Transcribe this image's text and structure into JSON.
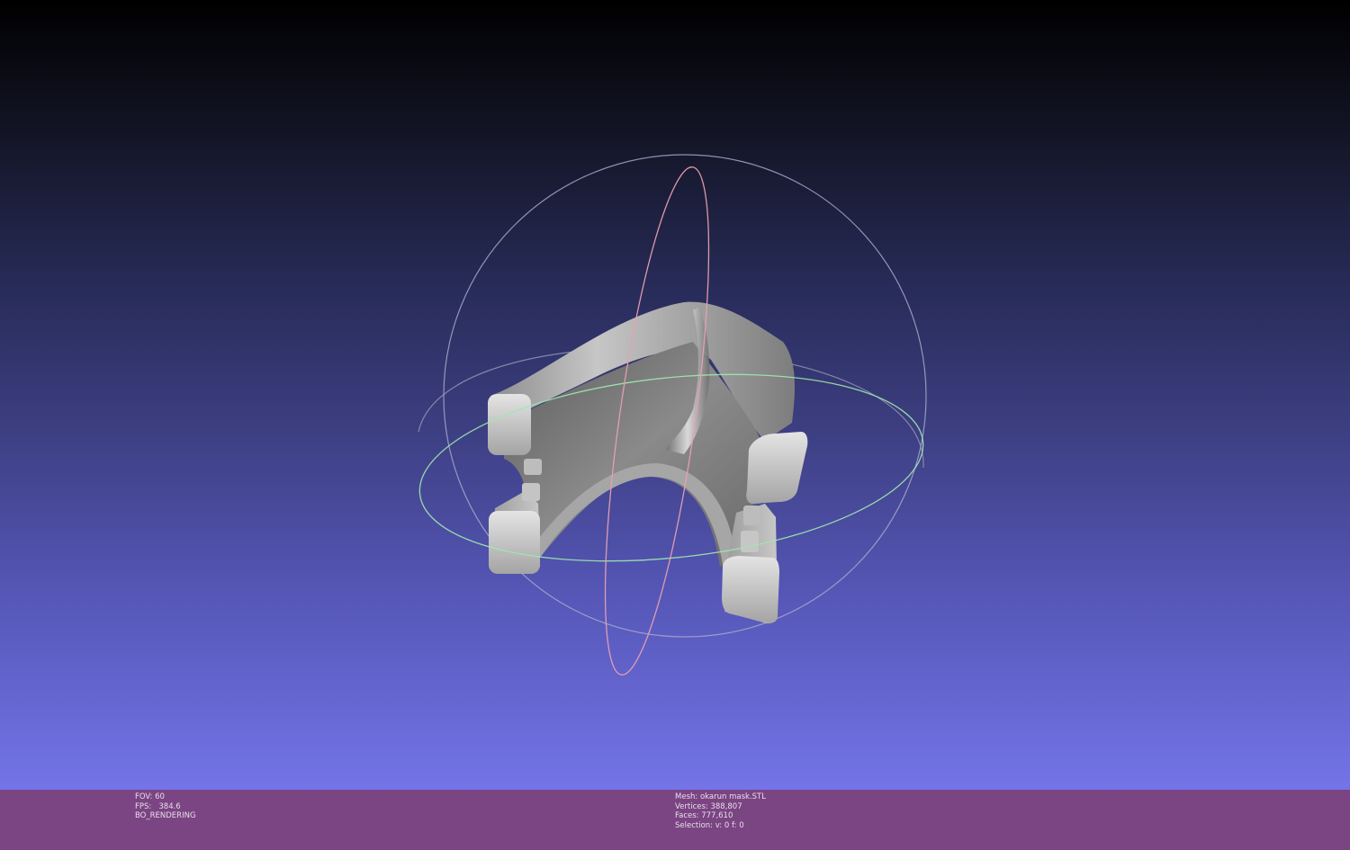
{
  "viewport": {
    "background_top": "#000000",
    "background_bottom": "#7474e8"
  },
  "trackball": {
    "x_ring_color": "#e8a0b0",
    "y_ring_color": "#a0e8b0",
    "z_ring_color": "#a8a8c8"
  },
  "mesh_color": "#b4b4b4",
  "status_bar": {
    "color": "#7b4483",
    "fov": "FOV: 60",
    "fps": "FPS:   384.6",
    "render_mode": "BO_RENDERING",
    "mesh_name": "Mesh: okarun mask.STL",
    "vertices": "Vertices: 388,807",
    "faces": "Faces: 777,610",
    "selection": "Selection: v: 0 f: 0"
  }
}
